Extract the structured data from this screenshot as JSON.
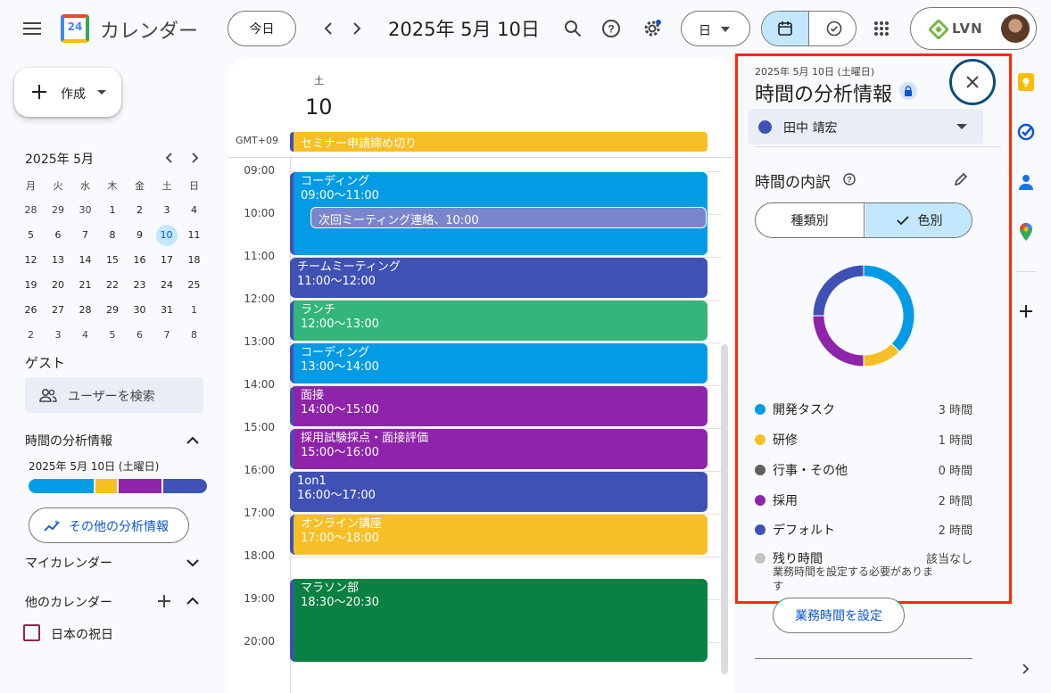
{
  "header": {
    "app_title": "カレンダー",
    "logo_day": "24",
    "today_label": "今日",
    "date_title": "2025年 5月 10日",
    "view_label": "日",
    "brand": "LVN"
  },
  "create": {
    "label": "作成"
  },
  "mini_calendar": {
    "title": "2025年 5月",
    "weekdays": [
      "月",
      "火",
      "水",
      "木",
      "金",
      "土",
      "日"
    ],
    "weeks": [
      [
        "28",
        "29",
        "30",
        "1",
        "2",
        "3",
        "4"
      ],
      [
        "5",
        "6",
        "7",
        "8",
        "9",
        "10",
        "11"
      ],
      [
        "12",
        "13",
        "14",
        "15",
        "16",
        "17",
        "18"
      ],
      [
        "19",
        "20",
        "21",
        "22",
        "23",
        "24",
        "25"
      ],
      [
        "26",
        "27",
        "28",
        "29",
        "30",
        "31",
        "1"
      ],
      [
        "2",
        "3",
        "4",
        "5",
        "6",
        "7",
        "8"
      ]
    ],
    "selected": "10"
  },
  "guests": {
    "title": "ゲスト",
    "search_placeholder": "ユーザーを検索"
  },
  "time_insights": {
    "title": "時間の分析情報",
    "date": "2025年 5月 10日 (土曜日)",
    "more_label": "その他の分析情報"
  },
  "my_calendars": {
    "title": "マイカレンダー"
  },
  "other_calendars": {
    "title": "他のカレンダー",
    "items": [
      {
        "label": "日本の祝日",
        "color": "#8e2454"
      }
    ]
  },
  "day_view": {
    "weekday": "土",
    "day": "10",
    "timezone": "GMT+09",
    "hours": [
      "09:00",
      "10:00",
      "11:00",
      "12:00",
      "13:00",
      "14:00",
      "15:00",
      "16:00",
      "17:00",
      "18:00",
      "19:00",
      "20:00"
    ],
    "allday_event": "セミナー申請締め切り",
    "events": [
      {
        "title": "コーディング",
        "time": "09:00～11:00",
        "color": "#039be5"
      },
      {
        "title": "チームミーティング",
        "time": "11:00～12:00",
        "color": "#3f51b5"
      },
      {
        "title": "ランチ",
        "time": "12:00～13:00",
        "color": "#33b679"
      },
      {
        "title": "コーディング",
        "time": "13:00～14:00",
        "color": "#039be5"
      },
      {
        "title": "面接",
        "time": "14:00～15:00",
        "color": "#8e24aa"
      },
      {
        "title": "採用試験採点・面接評価",
        "time": "15:00～16:00",
        "color": "#8e24aa"
      },
      {
        "title": "1on1",
        "time": "16:00～17:00",
        "color": "#3f51b5"
      },
      {
        "title": "オンライン講座",
        "time": "17:00～18:00",
        "color": "#f6bf26"
      },
      {
        "title": "マラソン部",
        "time": "18:30～20:30",
        "color": "#0b8043"
      }
    ],
    "reminder": "次回ミーティング連絡、10:00"
  },
  "panel": {
    "date": "2025年 5月 10日 (土曜日)",
    "title": "時間の分析情報",
    "person": "田中 靖宏",
    "breakdown_title": "時間の内訳",
    "toggle_type": "種類別",
    "toggle_color": "色別",
    "legend": [
      {
        "label": "開発タスク",
        "value": "3 時間",
        "color": "#039be5"
      },
      {
        "label": "研修",
        "value": "1 時間",
        "color": "#f6bf26"
      },
      {
        "label": "行事・その他",
        "value": "0 時間",
        "color": "#616161"
      },
      {
        "label": "採用",
        "value": "2 時間",
        "color": "#8e24aa"
      },
      {
        "label": "デフォルト",
        "value": "2 時間",
        "color": "#3f51b5"
      },
      {
        "label": "残り時間",
        "value": "該当なし",
        "color": "#c4c4c4"
      }
    ],
    "remaining_note": "業務時間を設定する必要がありま\nす",
    "set_hours_label": "業務時間を設定"
  },
  "chart_data": {
    "type": "pie",
    "categories": [
      "開発タスク",
      "研修",
      "採用",
      "デフォルト"
    ],
    "values": [
      3,
      1,
      2,
      2
    ],
    "colors": [
      "#039be5",
      "#f6bf26",
      "#8e24aa",
      "#3f51b5"
    ]
  },
  "colors": {
    "accent": "#0b57d0",
    "highlight_border": "#ff2a00",
    "selected_bg": "#c2e7ff"
  }
}
